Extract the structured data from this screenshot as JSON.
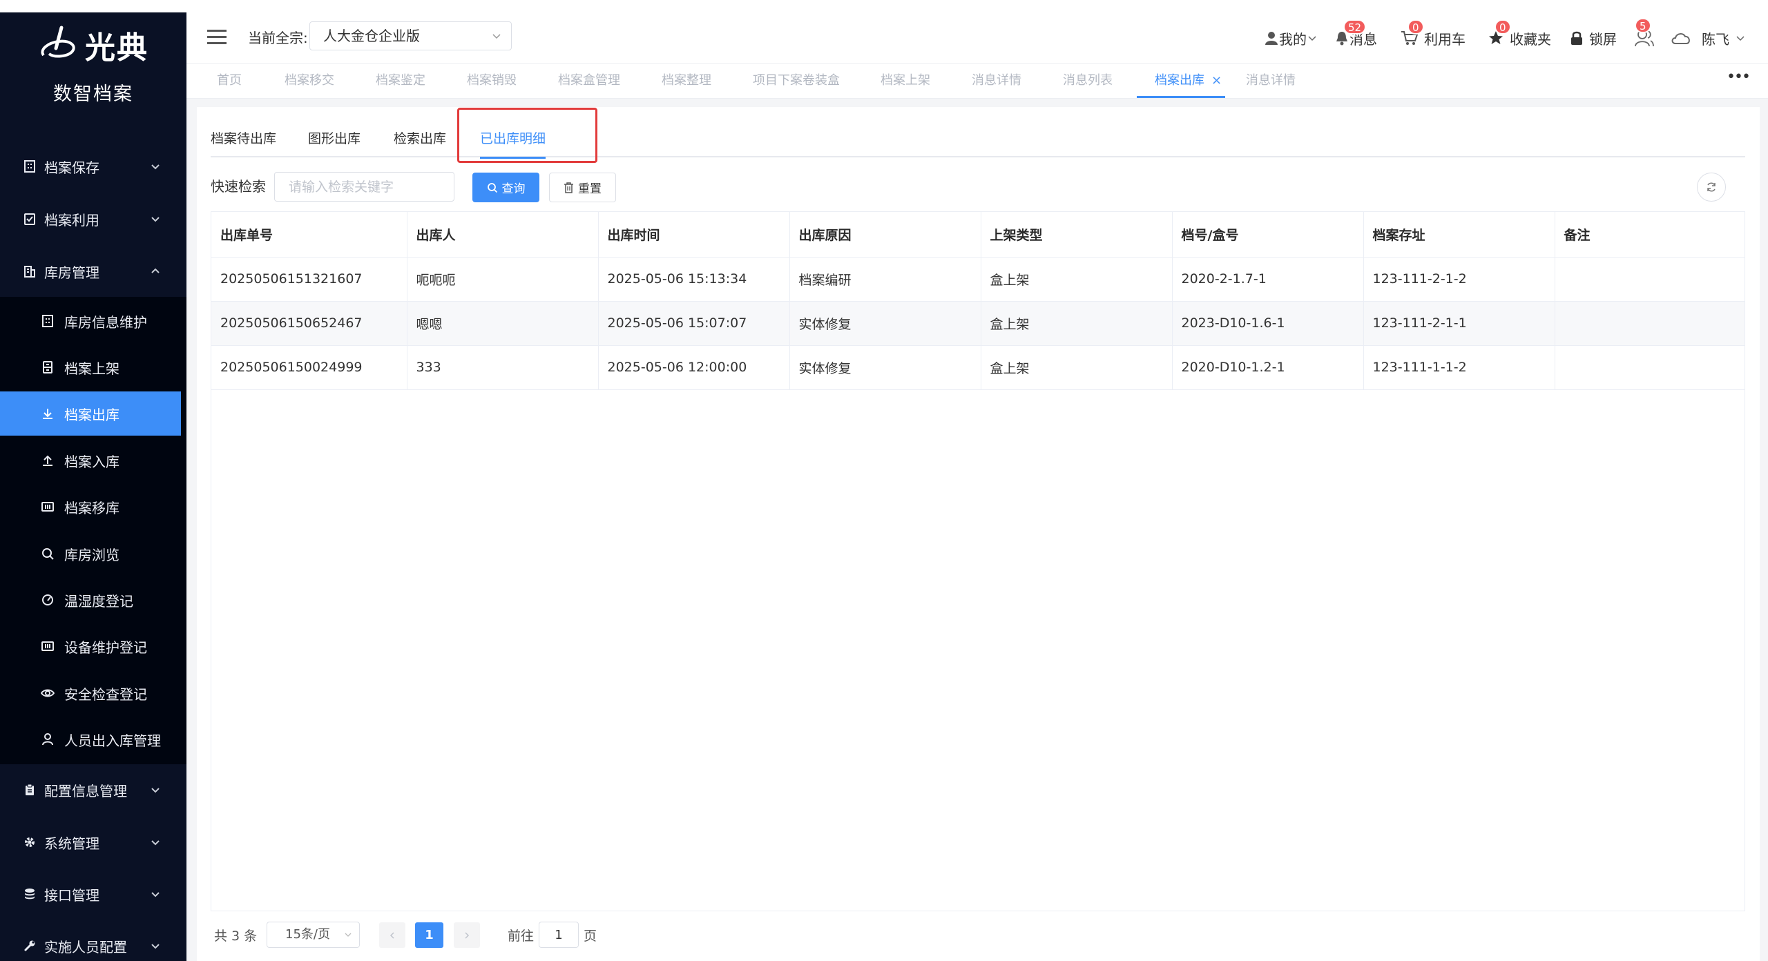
{
  "app": {
    "logo_text": "光典",
    "logo_subtitle": "数智档案"
  },
  "sidebar": {
    "items": [
      {
        "label": "档案保存",
        "icon": "building-icon"
      },
      {
        "label": "档案利用",
        "icon": "checklist-icon"
      },
      {
        "label": "库房管理",
        "icon": "warehouse-icon"
      },
      {
        "label": "配置信息管理",
        "icon": "clipboard-icon"
      },
      {
        "label": "系统管理",
        "icon": "gear-icon"
      },
      {
        "label": "接口管理",
        "icon": "database-icon"
      },
      {
        "label": "实施人员配置",
        "icon": "wrench-icon"
      }
    ],
    "sub_items": [
      {
        "label": "库房信息维护",
        "icon": "building-icon"
      },
      {
        "label": "档案上架",
        "icon": "cabinet-icon"
      },
      {
        "label": "档案出库",
        "icon": "download-icon"
      },
      {
        "label": "档案入库",
        "icon": "upload-icon"
      },
      {
        "label": "档案移库",
        "icon": "grid-icon"
      },
      {
        "label": "库房浏览",
        "icon": "search-icon"
      },
      {
        "label": "温湿度登记",
        "icon": "gauge-icon"
      },
      {
        "label": "设备维护登记",
        "icon": "grid-icon"
      },
      {
        "label": "安全检查登记",
        "icon": "eye-icon"
      },
      {
        "label": "人员出入库管理",
        "icon": "user-icon"
      }
    ]
  },
  "header": {
    "org_label": "当前全宗:",
    "org_value": "人大金仓企业版",
    "my_label": "我的",
    "messages_label": "消息",
    "messages_badge": "52",
    "cart_label": "利用车",
    "cart_badge": "0",
    "favorites_label": "收藏夹",
    "favorites_badge": "0",
    "lock_label": "锁屏",
    "users_badge": "5",
    "user_name": "陈飞"
  },
  "tabs": [
    {
      "label": "首页",
      "active": false
    },
    {
      "label": "档案移交",
      "active": false
    },
    {
      "label": "档案鉴定",
      "active": false
    },
    {
      "label": "档案销毁",
      "active": false
    },
    {
      "label": "档案盒管理",
      "active": false
    },
    {
      "label": "档案整理",
      "active": false
    },
    {
      "label": "项目下案卷装盒",
      "active": false
    },
    {
      "label": "档案上架",
      "active": false
    },
    {
      "label": "消息详情",
      "active": false
    },
    {
      "label": "消息列表",
      "active": false
    },
    {
      "label": "档案出库",
      "active": true
    },
    {
      "label": "消息详情",
      "active": false
    }
  ],
  "subtabs": [
    {
      "label": "档案待出库",
      "active": false
    },
    {
      "label": "图形出库",
      "active": false
    },
    {
      "label": "检索出库",
      "active": false
    },
    {
      "label": "已出库明细",
      "active": true
    }
  ],
  "search": {
    "label": "快速检索",
    "placeholder": "请输入检索关键字",
    "value": "",
    "query_label": "查询",
    "reset_label": "重置"
  },
  "table": {
    "columns": [
      "出库单号",
      "出库人",
      "出库时间",
      "出库原因",
      "上架类型",
      "档号/盒号",
      "档案存址",
      "备注"
    ],
    "rows": [
      [
        "20250506151321607",
        "呃呃呃",
        "2025-05-06 15:13:34",
        "档案编研",
        "盒上架",
        "2020-2-1.7-1",
        "123-111-2-1-2",
        ""
      ],
      [
        "20250506150652467",
        "嗯嗯",
        "2025-05-06 15:07:07",
        "实体修复",
        "盒上架",
        "2023-D10-1.6-1",
        "123-111-2-1-1",
        ""
      ],
      [
        "20250506150024999",
        "333",
        "2025-05-06 12:00:00",
        "实体修复",
        "盒上架",
        "2020-D10-1.2-1",
        "123-111-1-1-2",
        ""
      ]
    ]
  },
  "pagination": {
    "total_text": "共 3 条",
    "page_size": "15条/页",
    "current_page": "1",
    "goto_prefix": "前往",
    "goto_value": "1",
    "goto_suffix": "页"
  },
  "colors": {
    "accent": "#3d8ef8",
    "sidebar_bg": "#0a1125",
    "badge": "#f25c5c",
    "highlight": "#e23b3b"
  }
}
